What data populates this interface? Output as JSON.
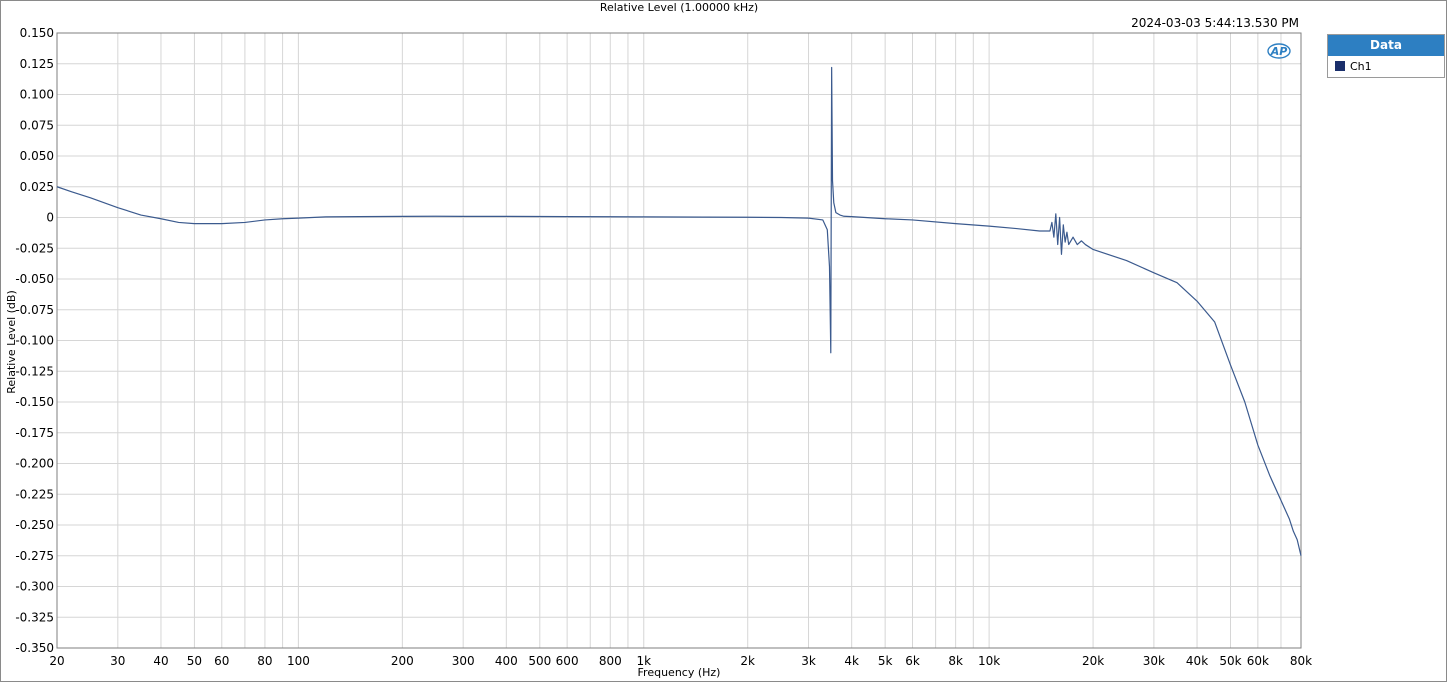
{
  "colors": {
    "trace": "#3b5a8e",
    "grid": "#d6d6d6",
    "axis": "#7f7f7f",
    "legend_header": "#2d7fc2",
    "legend_swatch": "#1a2f6b",
    "logo": "#2d7fc2"
  },
  "logo": {
    "text": "AP",
    "icon": "ap-logo-icon"
  },
  "legend": {
    "title": "Data",
    "entries": [
      "Ch1"
    ]
  },
  "chart_data": {
    "type": "line",
    "title": "Relative Level (1.00000 kHz)",
    "timestamp": "2024-03-03 5:44:13.530 PM",
    "xlabel": "Frequency (Hz)",
    "ylabel": "Relative Level (dB)",
    "x_scale": "log",
    "xlim": [
      20,
      80000
    ],
    "ylim": [
      -0.35,
      0.15
    ],
    "grid": true,
    "legend_position": "top-right outside",
    "x_ticks": [
      {
        "value": 20,
        "label": "20"
      },
      {
        "value": 30,
        "label": "30"
      },
      {
        "value": 40,
        "label": "40"
      },
      {
        "value": 50,
        "label": "50"
      },
      {
        "value": 60,
        "label": "60"
      },
      {
        "value": 80,
        "label": "80"
      },
      {
        "value": 100,
        "label": "100"
      },
      {
        "value": 200,
        "label": "200"
      },
      {
        "value": 300,
        "label": "300"
      },
      {
        "value": 400,
        "label": "400"
      },
      {
        "value": 500,
        "label": "500"
      },
      {
        "value": 600,
        "label": "600"
      },
      {
        "value": 800,
        "label": "800"
      },
      {
        "value": 1000,
        "label": "1k"
      },
      {
        "value": 2000,
        "label": "2k"
      },
      {
        "value": 3000,
        "label": "3k"
      },
      {
        "value": 4000,
        "label": "4k"
      },
      {
        "value": 5000,
        "label": "5k"
      },
      {
        "value": 6000,
        "label": "6k"
      },
      {
        "value": 8000,
        "label": "8k"
      },
      {
        "value": 10000,
        "label": "10k"
      },
      {
        "value": 20000,
        "label": "20k"
      },
      {
        "value": 30000,
        "label": "30k"
      },
      {
        "value": 40000,
        "label": "40k"
      },
      {
        "value": 50000,
        "label": "50k"
      },
      {
        "value": 60000,
        "label": "60k"
      },
      {
        "value": 80000,
        "label": "80k"
      }
    ],
    "y_ticks": [
      {
        "value": 0.15,
        "label": "0.150"
      },
      {
        "value": 0.125,
        "label": "0.125"
      },
      {
        "value": 0.1,
        "label": "0.100"
      },
      {
        "value": 0.075,
        "label": "0.075"
      },
      {
        "value": 0.05,
        "label": "0.050"
      },
      {
        "value": 0.025,
        "label": "0.025"
      },
      {
        "value": 0,
        "label": "0"
      },
      {
        "value": -0.025,
        "label": "-0.025"
      },
      {
        "value": -0.05,
        "label": "-0.050"
      },
      {
        "value": -0.075,
        "label": "-0.075"
      },
      {
        "value": -0.1,
        "label": "-0.100"
      },
      {
        "value": -0.125,
        "label": "-0.125"
      },
      {
        "value": -0.15,
        "label": "-0.150"
      },
      {
        "value": -0.175,
        "label": "-0.175"
      },
      {
        "value": -0.2,
        "label": "-0.200"
      },
      {
        "value": -0.225,
        "label": "-0.225"
      },
      {
        "value": -0.25,
        "label": "-0.250"
      },
      {
        "value": -0.275,
        "label": "-0.275"
      },
      {
        "value": -0.3,
        "label": "-0.300"
      },
      {
        "value": -0.325,
        "label": "-0.325"
      },
      {
        "value": -0.35,
        "label": "-0.350"
      }
    ],
    "series": [
      {
        "name": "Ch1",
        "x": [
          20,
          22,
          25,
          30,
          35,
          40,
          45,
          50,
          55,
          60,
          70,
          80,
          90,
          100,
          120,
          150,
          200,
          250,
          300,
          400,
          500,
          600,
          800,
          1000,
          1500,
          2000,
          2500,
          3000,
          3300,
          3400,
          3450,
          3480,
          3500,
          3520,
          3550,
          3600,
          3700,
          3800,
          4000,
          5000,
          6000,
          8000,
          10000,
          12000,
          14000,
          15000,
          15200,
          15400,
          15600,
          15800,
          16000,
          16200,
          16400,
          16600,
          16800,
          17000,
          17500,
          18000,
          18500,
          19000,
          20000,
          25000,
          30000,
          35000,
          40000,
          45000,
          50000,
          55000,
          60000,
          65000,
          70000,
          74000,
          76000,
          78000,
          80000
        ],
        "y": [
          0.025,
          0.021,
          0.016,
          0.008,
          0.002,
          -0.001,
          -0.004,
          -0.005,
          -0.005,
          -0.005,
          -0.004,
          -0.002,
          -0.001,
          -0.0005,
          0.0005,
          0.0007,
          0.0009,
          0.001,
          0.0009,
          0.0009,
          0.0008,
          0.0007,
          0.0006,
          0.0005,
          0.0003,
          0.0002,
          0.0,
          -0.0005,
          -0.002,
          -0.01,
          -0.04,
          -0.11,
          0.122,
          0.03,
          0.012,
          0.004,
          0.002,
          0.001,
          0.0007,
          -0.001,
          -0.002,
          -0.005,
          -0.007,
          -0.009,
          -0.011,
          -0.011,
          -0.004,
          -0.016,
          0.003,
          -0.022,
          0.0,
          -0.03,
          -0.006,
          -0.02,
          -0.012,
          -0.022,
          -0.016,
          -0.022,
          -0.019,
          -0.022,
          -0.026,
          -0.035,
          -0.045,
          -0.053,
          -0.068,
          -0.085,
          -0.12,
          -0.15,
          -0.185,
          -0.21,
          -0.23,
          -0.245,
          -0.255,
          -0.262,
          -0.275
        ]
      }
    ]
  }
}
